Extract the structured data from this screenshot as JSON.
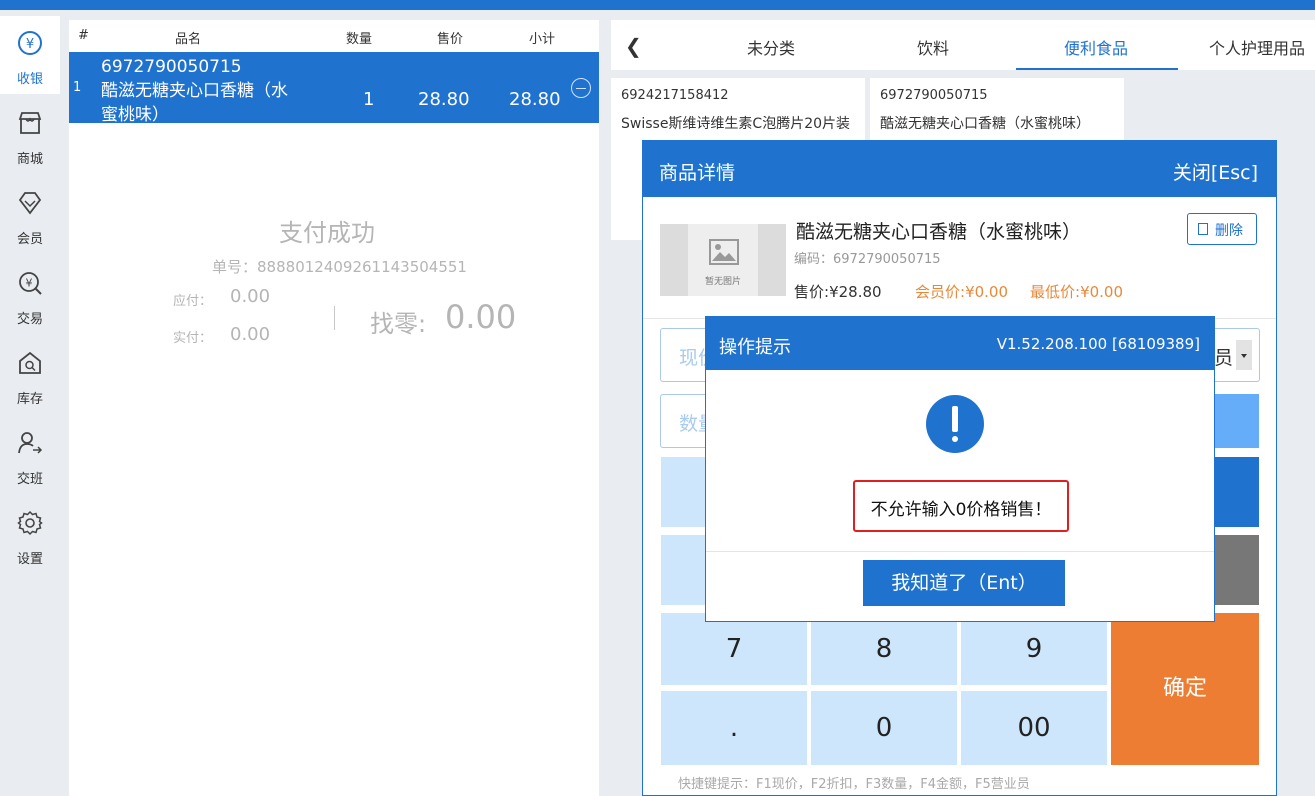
{
  "colors": {
    "primary": "#1f73cf",
    "accent_orange": "#ec7d33",
    "alert_red": "#e02020",
    "key_blue": "#cde6fb"
  },
  "sidebar": {
    "items": [
      {
        "label": "收银",
        "icon": "cashier-icon",
        "active": true
      },
      {
        "label": "商城",
        "icon": "store-icon",
        "active": false
      },
      {
        "label": "会员",
        "icon": "member-diamond-icon",
        "active": false
      },
      {
        "label": "交易",
        "icon": "transaction-search-icon",
        "active": false
      },
      {
        "label": "库存",
        "icon": "inventory-icon",
        "active": false
      },
      {
        "label": "交班",
        "icon": "shift-handover-icon",
        "active": false
      },
      {
        "label": "设置",
        "icon": "gear-icon",
        "active": false
      }
    ]
  },
  "cart": {
    "headers": {
      "index": "#",
      "name": "品名",
      "qty": "数量",
      "price": "售价",
      "subtotal": "小计"
    },
    "rows": [
      {
        "index": "1",
        "code": "6972790050715",
        "name": "酷滋无糖夹心口香糖（水蜜桃味）",
        "qty": "1",
        "price": "28.80",
        "subtotal": "28.80"
      }
    ]
  },
  "payment": {
    "status": "支付成功",
    "order_label": "单号：",
    "order_no": "888801240926114350455­1",
    "due_label": "应付：",
    "due": "0.00",
    "paid_label": "实付：",
    "paid": "0.00",
    "change_label": "找零:",
    "change": "0.00"
  },
  "categories": {
    "tabs": [
      "未分类",
      "饮料",
      "便利食品",
      "个人护理用品"
    ],
    "active": "便利食品"
  },
  "products": [
    {
      "code": "6924217158412",
      "name": "Swisse斯维诗维生素C泡腾片20片装"
    },
    {
      "code": "6972790050715",
      "name": "酷滋无糖夹心口香糖（水蜜桃味）"
    }
  ],
  "detail": {
    "title": "商品详情",
    "close": "关闭[Esc]",
    "no_image": "暂无图片",
    "name": "酷滋无糖夹心口香糖（水蜜桃味）",
    "code_label": "编码：",
    "code": "6972790050715",
    "price_label": "售价:",
    "price": "¥28.80",
    "member_label": "会员价:",
    "member_price": "¥0.00",
    "min_label": "最低价:",
    "min_price": "¥0.00",
    "delete": "删除",
    "price_input_placeholder": "现价",
    "qty_input_placeholder": "数量",
    "salesperson_suffix": "员",
    "keys": [
      "7",
      "8",
      "9",
      ".",
      "0",
      "00"
    ],
    "confirm": "确定",
    "hint": "快捷键提示：F1现价，F2折扣，F3数量，F4金额，F5营业员"
  },
  "alert": {
    "title": "操作提示",
    "version": "V1.52.208.100 [68109389]",
    "message": "不允许输入0价格销售！",
    "button": "我知道了（Ent）"
  }
}
